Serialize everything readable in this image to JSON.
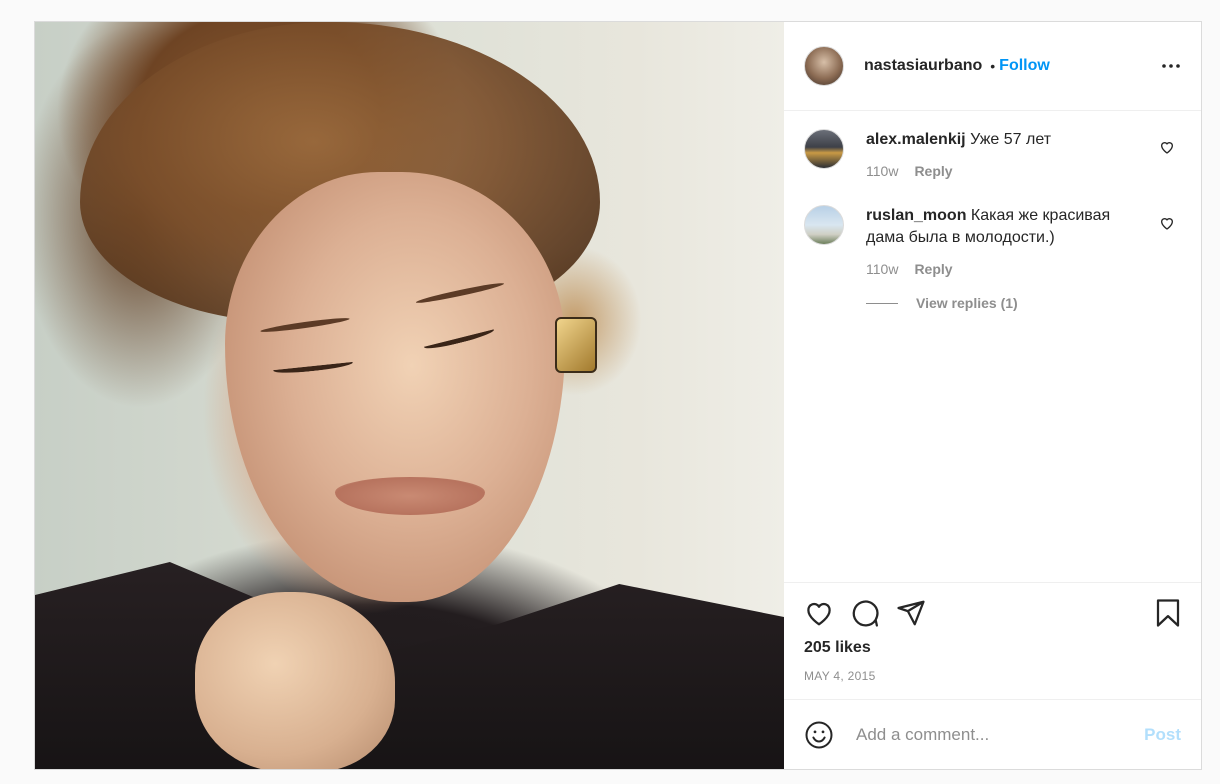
{
  "post": {
    "owner": {
      "username": "nastasiaurbano",
      "separator": "•",
      "follow_label": "Follow"
    },
    "more_icon": "more-horizontal-icon",
    "comments": [
      {
        "username": "alex.malenkij",
        "text": "Уже 57 лет",
        "age": "110w",
        "reply_label": "Reply"
      },
      {
        "username": "ruslan_moon",
        "text": "Какая же красивая дама была в молодости.)",
        "age": "110w",
        "reply_label": "Reply"
      }
    ],
    "view_replies": "View replies (1)",
    "likes": "205 likes",
    "date": "MAY 4, 2015",
    "add_comment": {
      "placeholder": "Add a comment...",
      "post_label": "Post"
    },
    "icons": [
      "heart-icon",
      "comment-icon",
      "share-icon",
      "bookmark-icon",
      "emoji-icon"
    ],
    "colors": {
      "accent": "#0095f6",
      "post_disabled": "#b2dffc",
      "text": "#262626",
      "muted": "#8e8e8e"
    }
  }
}
